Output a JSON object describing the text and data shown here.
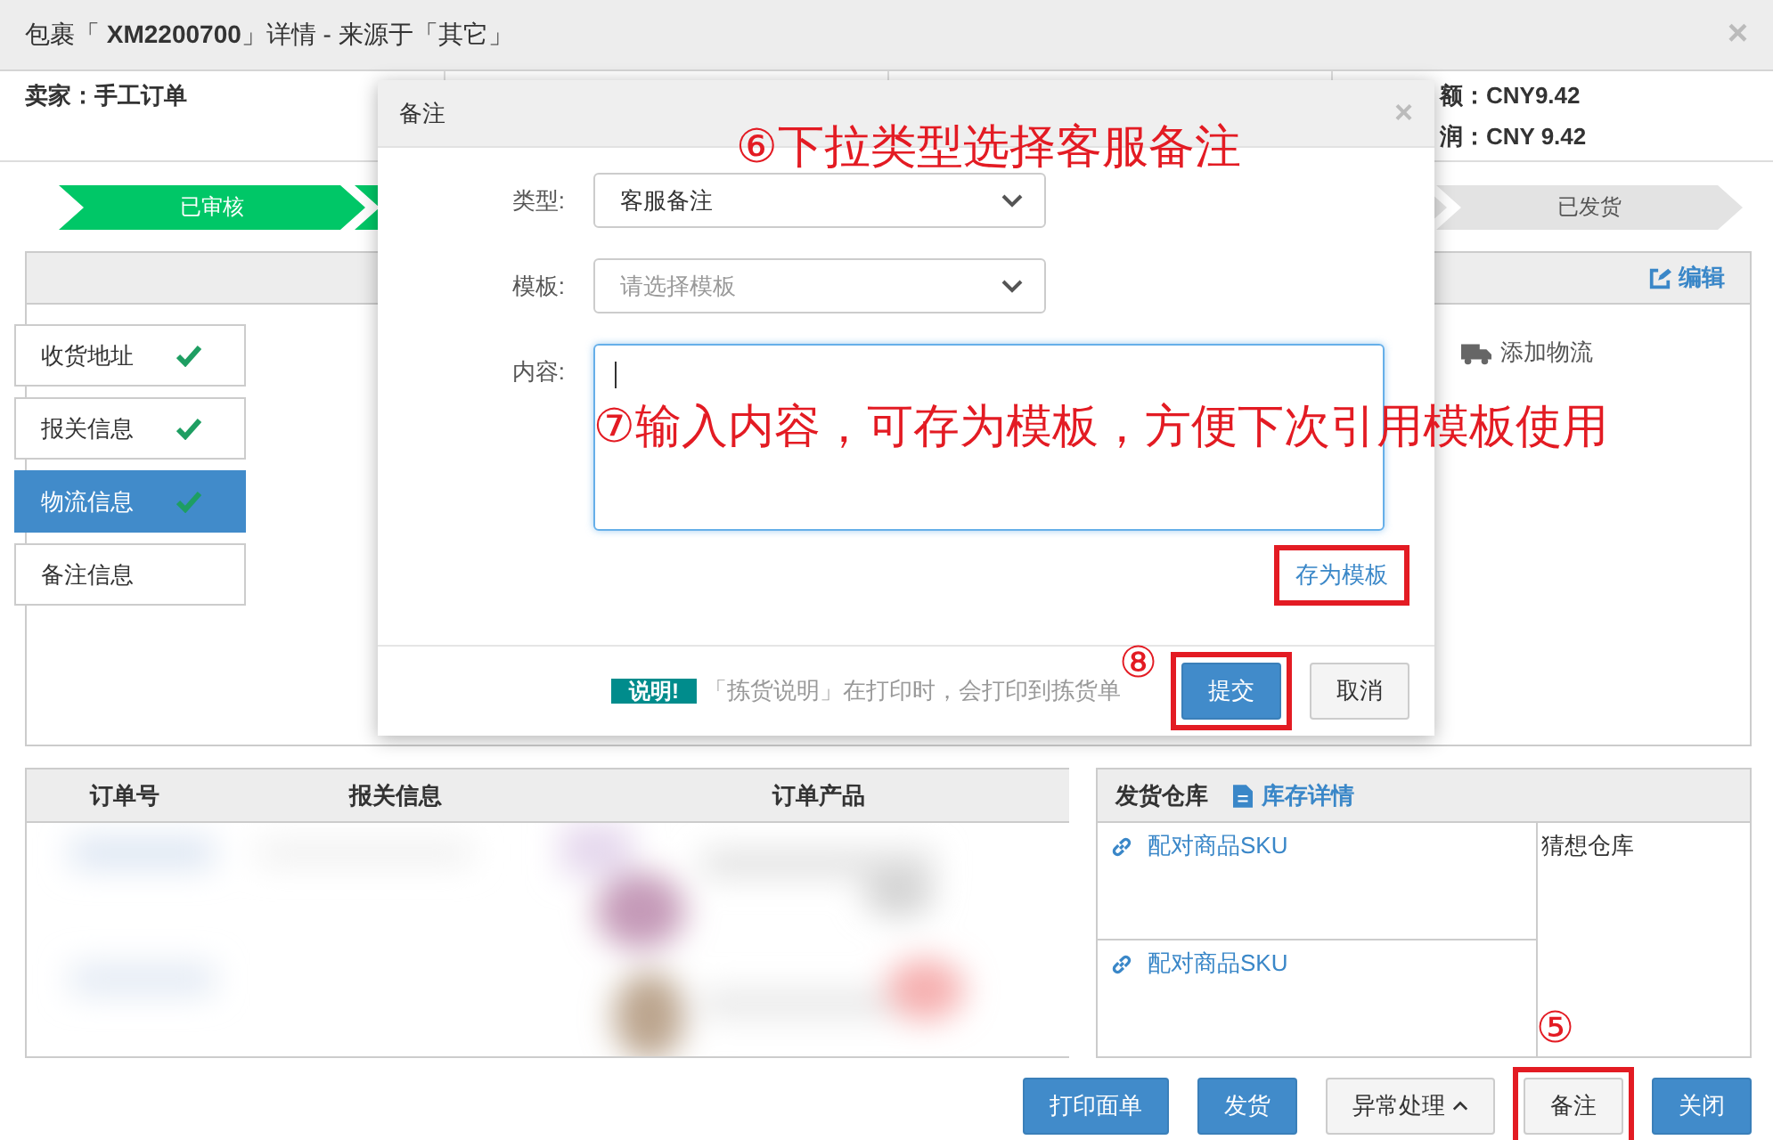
{
  "window": {
    "title": "包裹「 **XM2200700**」详情 - 来源于「其它」",
    "close": "×"
  },
  "summary": {
    "seller": "卖家：手工订单",
    "amount_lines": [
      "额：CNY9.42",
      "润：CNY 9.42"
    ]
  },
  "steps": [
    {
      "label": "已审核",
      "done": true
    },
    {
      "done": true
    },
    {
      "done": false
    },
    {
      "label": "已发货",
      "done": false
    }
  ],
  "detail_panel": {
    "edit_link": "编辑",
    "add_logistics": "添加物流",
    "tabs": [
      {
        "label": "收货地址",
        "checked": true,
        "selected": false
      },
      {
        "label": "报关信息",
        "checked": true,
        "selected": false
      },
      {
        "label": "物流信息",
        "checked": true,
        "selected": true
      },
      {
        "label": "备注信息",
        "checked": false,
        "selected": false
      }
    ]
  },
  "orders_table": {
    "columns": [
      "订单号",
      "报关信息",
      "订单产品"
    ],
    "body": {
      "kind": "picture"
    }
  },
  "warehouse": {
    "title": "发货仓库",
    "stock_link": "库存详情",
    "sku_links": [
      "配对商品SKU",
      "配对商品SKU"
    ],
    "warehouse_name": "猜想仓库"
  },
  "actions": [
    {
      "label": "打印面单",
      "kind": "primary",
      "highlighted": false
    },
    {
      "label": "发货",
      "kind": "primary",
      "highlighted": false
    },
    {
      "label": "异常处理",
      "kind": "dropdown",
      "highlighted": false
    },
    {
      "label": "备注",
      "kind": "default",
      "highlighted": true,
      "marker": "⑤"
    },
    {
      "label": "关闭",
      "kind": "primary",
      "highlighted": false
    }
  ],
  "dialog": {
    "title": "备注",
    "close": "×",
    "fields": [
      {
        "kind": "select",
        "label": "类型:",
        "value": "客服备注",
        "annotation": "⑥下拉类型选择客服备注"
      },
      {
        "kind": "select",
        "label": "模板:",
        "placeholder": "请选择模板"
      },
      {
        "kind": "textarea",
        "label": "内容:",
        "annotation": "⑦输入内容，可存为模板，方便下次引用模板使用"
      }
    ],
    "save_template": {
      "label": "存为模板",
      "highlighted": true
    },
    "note_badge": "说明!",
    "note_text": "「拣货说明」在打印时，会打印到拣货单",
    "buttons": [
      {
        "label": "提交",
        "kind": "primary",
        "highlighted": true,
        "marker": "⑧"
      },
      {
        "label": "取消",
        "kind": "default",
        "highlighted": false
      }
    ]
  }
}
